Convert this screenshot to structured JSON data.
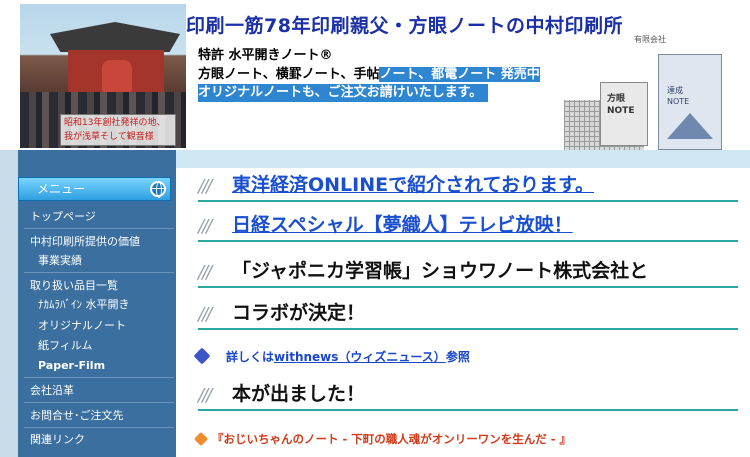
{
  "header": {
    "photo_caption_1": "昭和13年創社発祥の地、",
    "photo_caption_2": "我が浅草そして観音様",
    "site_title": "印刷一筋78年印刷親父・方眼ノートの中村印刷所",
    "patent_line": "特許 水平開きノート®",
    "product_line_plain": "方眼ノート、横罫ノート、手帖",
    "product_line_highlight": "ノート、都電ノート 発売中",
    "original_line": "オリジナルノートも、ご注文お請けいたします。",
    "notebook_label_1": "方眼\nNOTE",
    "notebook_label_2": "達成\nNOTE",
    "corp_label": "有限会社"
  },
  "sidebar": {
    "menu_label": "メニュー",
    "items": [
      {
        "label": "トップページ"
      },
      {
        "label": "中村印刷所提供の価値"
      },
      {
        "label": "事業実績"
      },
      {
        "label": "取り扱い品目一覧"
      },
      {
        "label": "ﾅｶﾑﾗﾊﾞｲﾝ 水平開き"
      },
      {
        "label": "オリジナルノート"
      },
      {
        "label": "紙フィルム"
      },
      {
        "label": "Paper-Film"
      },
      {
        "label": "会社沿革"
      },
      {
        "label": "お問合せ･ご注文先"
      },
      {
        "label": "関連リンク"
      }
    ]
  },
  "main": {
    "headlines": [
      "東洋経済ONLINEで紹介されております。",
      "日経スペシャル【夢織人】テレビ放映！",
      "「ジャポニカ学習帳」ショウワノート株式会社と",
      "コラボが決定！",
      "本が出ました！"
    ],
    "detail_prefix": "詳しくは",
    "detail_link": "withnews（ウィズニュース）",
    "detail_suffix": "参照",
    "book_link": "『おじいちゃんのノート - 下町の職人魂がオンリーワンを生んだ - 』",
    "slashes": "///"
  }
}
